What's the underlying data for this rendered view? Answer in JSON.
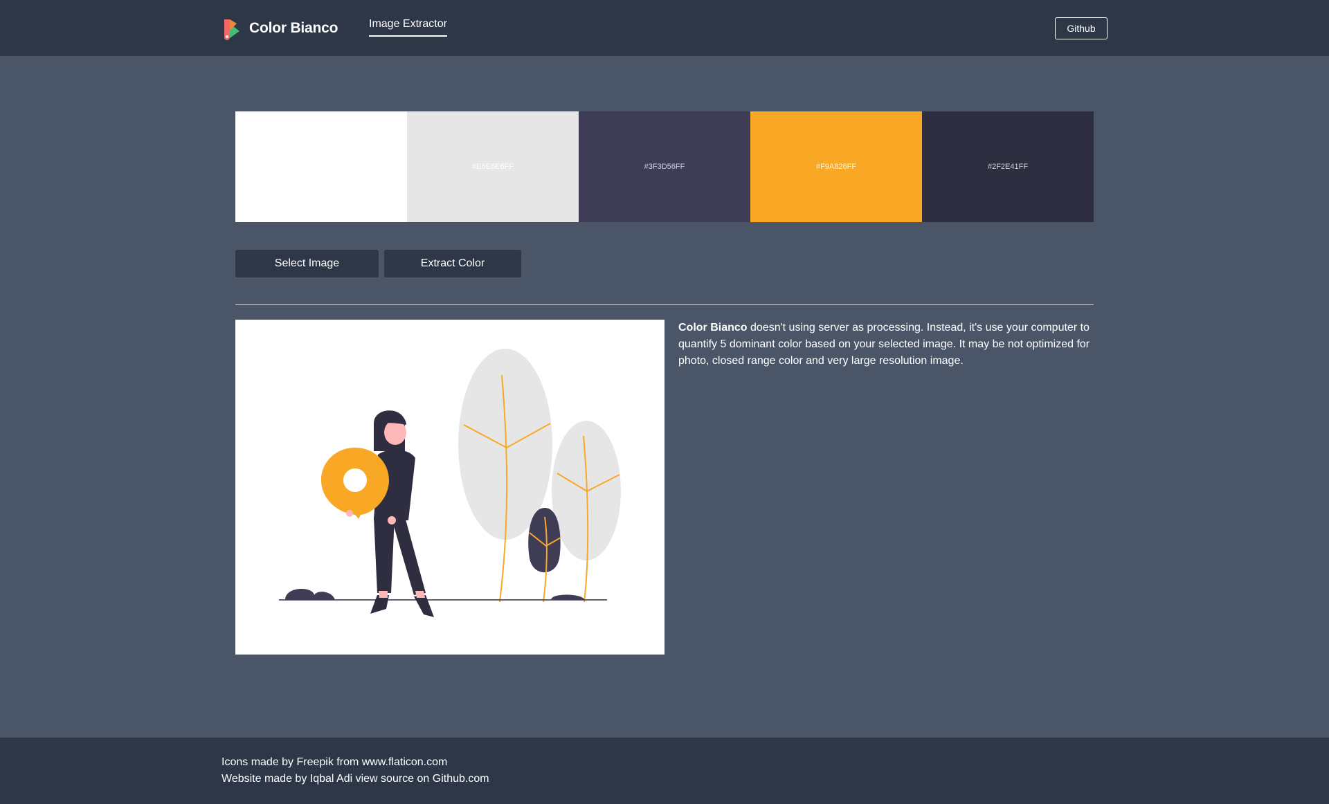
{
  "header": {
    "brand_name": "Color Bianco",
    "nav_link": "Image Extractor",
    "github_label": "Github"
  },
  "palette": [
    {
      "label": "",
      "color": "#FFFFFF",
      "text_color": "#FFFFFF"
    },
    {
      "label": "#E6E6E6FF",
      "color": "#E6E6E6",
      "text_color": "#FFFFFF"
    },
    {
      "label": "#3F3D56FF",
      "color": "#3F3D56",
      "text_color": "#CBD5E0"
    },
    {
      "label": "#F9A826FF",
      "color": "#F9A826",
      "text_color": "#FFF3D6"
    },
    {
      "label": "#2F2E41FF",
      "color": "#2F2E41",
      "text_color": "#CBD5E0"
    }
  ],
  "actions": {
    "select_label": "Select Image",
    "extract_label": "Extract Color"
  },
  "description": {
    "brand": "Color Bianco",
    "text": " doesn't using server as processing. Instead, it's use your computer to quantify 5 dominant color based on your selected image. It may be not optimized for photo, closed range color and very large resolution image."
  },
  "footer": {
    "line1": "Icons made by Freepik from www.flaticon.com",
    "line2": "Website made by Iqbal Adi view source on Github.com"
  },
  "colors": {
    "header_bg": "#2D3748",
    "page_bg": "#4A5568",
    "accent": "#F9A826",
    "dark": "#2F2E41"
  },
  "icons": {
    "logo": "palette-icon",
    "illustration": "woman-holding-location-pin-illustration"
  }
}
